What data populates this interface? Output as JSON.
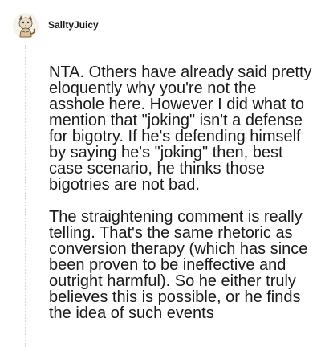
{
  "comment": {
    "author": "SalltyJuicy",
    "avatar_icon": "snoo-avatar-icon",
    "paragraphs": [
      "NTA. Others have already said pretty eloquently why you're not the asshole here. However I did what to mention that \"joking\" isn't a defense for bigotry. If he's defending himself by saying he's \"joking\" then, best case scenario, he thinks those bigotries are not bad.",
      "The straightening comment is really telling. That's the same rhetoric as conversion therapy (which has since been proven to be ineffective and outright harmful). So he either truly believes this is possible, or he finds the idea of such events"
    ]
  },
  "colors": {
    "text": "#1a1a1b",
    "thread_line": "#d6d6d6",
    "avatar_fur": "#e8e1d4",
    "avatar_ring": "#f3ede3"
  }
}
